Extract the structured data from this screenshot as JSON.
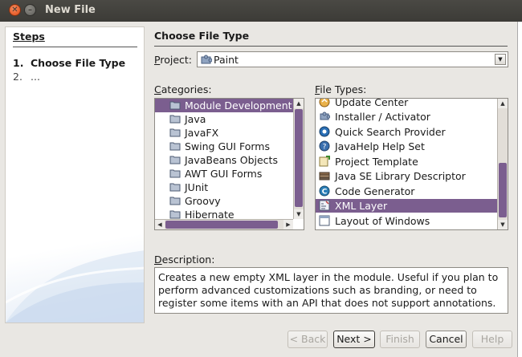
{
  "window": {
    "title": "New File"
  },
  "steps": {
    "title": "Steps",
    "items": [
      {
        "num": "1.",
        "label": "Choose File Type"
      },
      {
        "num": "2.",
        "label": "..."
      }
    ]
  },
  "main": {
    "title": "Choose File Type",
    "project_label_mnemonic": "P",
    "project_label_rest": "roject:",
    "project_value": "Paint",
    "categories_label_mnemonic": "C",
    "categories_label_rest": "ategories:",
    "filetypes_label_mnemonic": "F",
    "filetypes_label_rest": "ile Types:",
    "description_label_mnemonic": "D",
    "description_label_rest": "escription:",
    "description_text": "Creates a new empty XML layer in the module. Useful if you plan to perform advanced customizations such as branding, or need to register some items with an API that does not support annotations."
  },
  "categories": [
    {
      "label": "Module Development",
      "selected": true
    },
    {
      "label": "Java",
      "selected": false
    },
    {
      "label": "JavaFX",
      "selected": false
    },
    {
      "label": "Swing GUI Forms",
      "selected": false
    },
    {
      "label": "JavaBeans Objects",
      "selected": false
    },
    {
      "label": "AWT GUI Forms",
      "selected": false
    },
    {
      "label": "JUnit",
      "selected": false
    },
    {
      "label": "Groovy",
      "selected": false
    },
    {
      "label": "Hibernate",
      "selected": false
    }
  ],
  "file_types": [
    {
      "label": "Update Center",
      "icon": "update-center-icon",
      "selected": false
    },
    {
      "label": "Installer / Activator",
      "icon": "installer-icon",
      "selected": false
    },
    {
      "label": "Quick Search Provider",
      "icon": "quick-search-icon",
      "selected": false
    },
    {
      "label": "JavaHelp Help Set",
      "icon": "help-set-icon",
      "selected": false
    },
    {
      "label": "Project Template",
      "icon": "project-template-icon",
      "selected": false
    },
    {
      "label": "Java SE Library Descriptor",
      "icon": "library-descriptor-icon",
      "selected": false
    },
    {
      "label": "Code Generator",
      "icon": "code-generator-icon",
      "selected": false
    },
    {
      "label": "XML Layer",
      "icon": "xml-layer-icon",
      "selected": true
    },
    {
      "label": "Layout of Windows",
      "icon": "window-layout-icon",
      "selected": false
    }
  ],
  "buttons": {
    "back": {
      "label": "< Back",
      "enabled": false
    },
    "next": {
      "label": "Next >",
      "enabled": true
    },
    "finish": {
      "label": "Finish",
      "enabled": false
    },
    "cancel": {
      "label": "Cancel",
      "enabled": true
    },
    "help": {
      "label": "Help",
      "enabled": false
    }
  },
  "colors": {
    "selection": "#7b5e8f",
    "titlebar": "#3c3b37",
    "close_button": "#df4a16"
  }
}
